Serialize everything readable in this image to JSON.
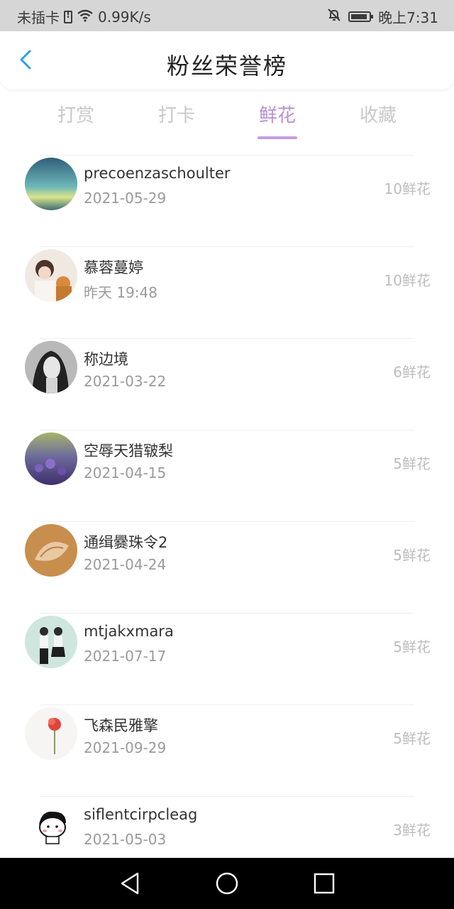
{
  "status": {
    "carrier": "未插卡",
    "speed": "0.99K/s",
    "time": "晚上7:31"
  },
  "header": {
    "title": "粉丝荣誉榜"
  },
  "tabs": [
    {
      "label": "打赏",
      "active": false
    },
    {
      "label": "打卡",
      "active": false
    },
    {
      "label": "鲜花",
      "active": true
    },
    {
      "label": "收藏",
      "active": false
    }
  ],
  "accent_color": "#b98fd6",
  "list": [
    {
      "name": "precoenzaschoulter",
      "date": "2021-05-29",
      "amount": "10鲜花",
      "avatar": "sky-sunset"
    },
    {
      "name": "慕蓉蔓婷",
      "date": "昨天 19:48",
      "amount": "10鲜花",
      "avatar": "person-with-cat"
    },
    {
      "name": "称边境",
      "date": "2021-03-22",
      "amount": "6鲜花",
      "avatar": "portrait-woman-bw"
    },
    {
      "name": "空辱天猎皲梨",
      "date": "2021-04-15",
      "amount": "5鲜花",
      "avatar": "lavender-field"
    },
    {
      "name": "通缉爨珠令2",
      "date": "2021-04-24",
      "amount": "5鲜花",
      "avatar": "seashell"
    },
    {
      "name": "mtjakxmara",
      "date": "2021-07-17",
      "amount": "5鲜花",
      "avatar": "couple"
    },
    {
      "name": "飞森民雅擎",
      "date": "2021-09-29",
      "amount": "5鲜花",
      "avatar": "red-flower"
    },
    {
      "name": "siflentcirpcleag",
      "date": "2021-05-03",
      "amount": "3鲜花",
      "avatar": "cartoon-kid"
    }
  ]
}
